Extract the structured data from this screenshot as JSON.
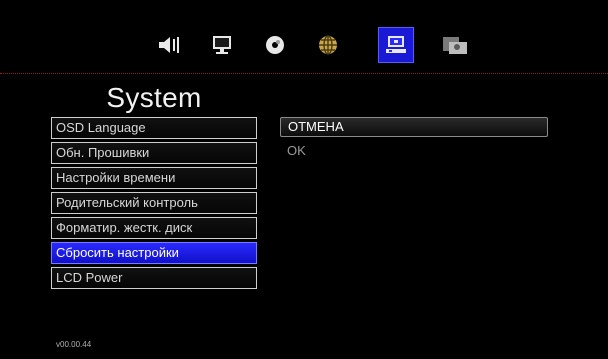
{
  "tabs": [
    {
      "name": "speaker-icon",
      "active": false
    },
    {
      "name": "monitor-icon",
      "active": false
    },
    {
      "name": "disc-icon",
      "active": false
    },
    {
      "name": "globe-icon",
      "active": false
    },
    {
      "name": "system-icon",
      "active": true
    },
    {
      "name": "photo-icon",
      "active": false
    }
  ],
  "page": {
    "title": "System"
  },
  "menu": {
    "items": [
      {
        "label": "OSD Language"
      },
      {
        "label": "Обн. Прошивки"
      },
      {
        "label": "Настройки времени"
      },
      {
        "label": "Родительский контроль"
      },
      {
        "label": "Форматир. жестк. диск"
      },
      {
        "label": "Сбросить настройки"
      },
      {
        "label": "LCD Power"
      }
    ],
    "selected_index": 5
  },
  "options": {
    "items": [
      {
        "label": "ОТМЕНА"
      },
      {
        "label": "OK"
      }
    ],
    "focused_index": 0
  },
  "footer": {
    "version": "v00.00.44"
  },
  "colors": {
    "accent": "#1a1ad6",
    "divider": "#9a1a1a",
    "background": "#000000"
  }
}
